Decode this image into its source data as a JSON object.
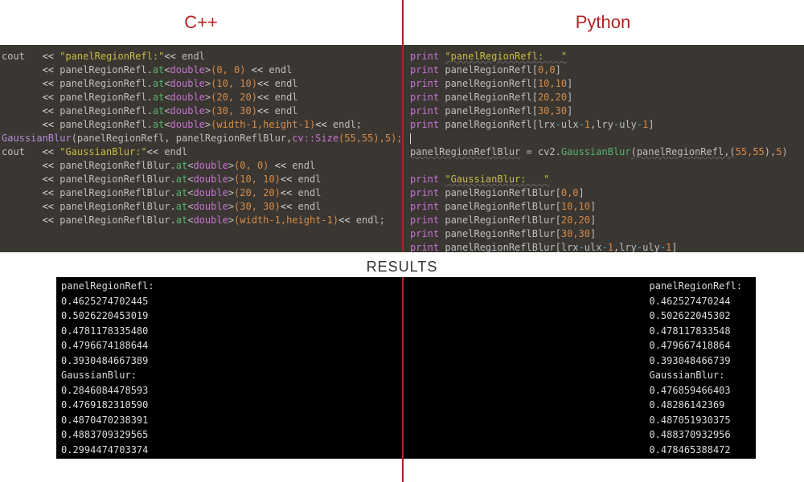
{
  "headers": {
    "cpp": "C++",
    "python": "Python"
  },
  "cpp": {
    "l1_cout": "cout   ",
    "l1_op": "<<",
    "l1_str": " \"panelRegionRefl:\"",
    "l1_op2": "<<",
    "l1_endl": " endl",
    "l2_indent": "       ",
    "l2_op": "<<",
    "l2_ident": " panelRegionRefl",
    "l2_dot": ".",
    "l2_at": "at",
    "l2_lt": "<",
    "l2_type": "double",
    "l2_gt": ">",
    "l2_p": "(0, 0) ",
    "l2_op2": "<<",
    "l2_endl": " endl",
    "l3_p": "(10, 10)",
    "l4_p": "(20, 20)",
    "l5_p": "(30, 30)",
    "l6_p": "(width-1,height-1)",
    "gb_call": "GaussianBlur",
    "gb_args1": "(panelRegionRefl, panelRegionReflBlur,",
    "gb_cvsize": "cv::Size",
    "gb_args2": "(55,55),5);",
    "l8_str": " \"GaussianBlur:\"",
    "blur_ident": " panelRegionReflBlur",
    "semi_endl": ";"
  },
  "py": {
    "l1": "print ",
    "l1s": "\"panelRegionRefl:   \"",
    "l2": "print ",
    "l2i": "panelRegionRefl[",
    "l2n": "0,0",
    "l2b": "]",
    "l3n": "10,10",
    "l4n": "20,20",
    "l5n": "30,30",
    "l6a": "lrx",
    "l6op": "-",
    "l6b": "ulx",
    "l6c": "-1",
    "l6d": "lry",
    "l6e": "uly",
    "gb_lhs": "panelRegionReflBlur",
    "gb_eq": " = ",
    "gb_cv2": "cv2",
    "gb_dot": ".",
    "gb_fn": "GaussianBlur",
    "gb_args_a": "(panelRegionRefl,(",
    "gb_args_b": "55,55",
    "gb_args_c": "),",
    "gb_args_d": "5",
    "gb_args_e": ")",
    "gbs": "\"GaussianBlur:   \"",
    "blur_i": "panelRegionReflBlur["
  },
  "results_label": "RESULTS",
  "results_cpp": {
    "h1": "panelRegionRefl:",
    "r1": "0.4625274702445",
    "r2": "0.5026220453019",
    "r3": "0.4781178335480",
    "r4": "0.4796674188644",
    "r5": "0.3930484667389",
    "h2": "GaussianBlur:",
    "g1": "0.2846084478593",
    "g2": "0.4769182310590",
    "g3": "0.4870470238391",
    "g4": "0.4883709329565",
    "g5": "0.2994474703374"
  },
  "results_py": {
    "h1": "panelRegionRefl:",
    "r1": "0.462527470244",
    "r2": "0.502622045302",
    "r3": "0.478117833548",
    "r4": "0.479667418864",
    "r5": "0.393048466739",
    "h2": "GaussianBlur:",
    "g1": "0.476859466403",
    "g2": "0.48286142369",
    "g3": "0.487051930375",
    "g4": "0.488370932956",
    "g5": "0.478465388472"
  }
}
